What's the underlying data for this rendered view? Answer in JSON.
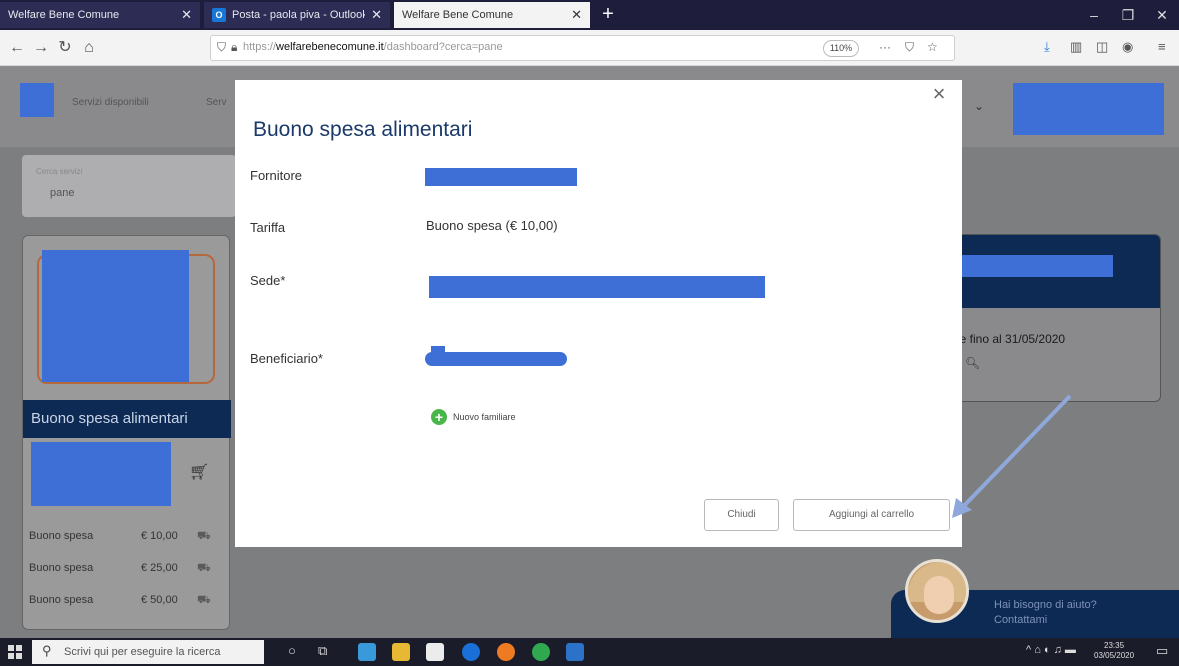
{
  "browser": {
    "tabs": [
      {
        "title": "Welfare Bene Comune",
        "active": false
      },
      {
        "title": "Posta - paola piva - Outlook",
        "active": false
      },
      {
        "title": "Welfare Bene Comune",
        "active": true
      }
    ],
    "url_prefix": "https://",
    "url_domain": "welfarebenecomune.it",
    "url_path": "/dashboard?cerca=pane",
    "zoom": "110%"
  },
  "page": {
    "nav_items": [
      "Servizi disponibili",
      "Serv"
    ],
    "search_label": "Cerca servizi",
    "search_value": "pane",
    "product": {
      "title": "Buono spesa alimentari",
      "prices": [
        {
          "label": "Buono spesa",
          "amount": "€ 10,00"
        },
        {
          "label": "Buono spesa",
          "amount": "€ 25,00"
        },
        {
          "label": "Buono spesa",
          "amount": "€ 50,00"
        }
      ]
    },
    "right_card_text": "le fino al 31/05/2020",
    "chat": {
      "line1": "Hai bisogno di aiuto?",
      "line2": "Contattami"
    }
  },
  "modal": {
    "title": "Buono spesa alimentari",
    "fields": {
      "fornitore_label": "Fornitore",
      "tariffa_label": "Tariffa",
      "tariffa_value": "Buono spesa (€ 10,00)",
      "sede_label": "Sede*",
      "beneficiario_label": "Beneficiario*"
    },
    "nuovo_familiare": "Nuovo familiare",
    "buttons": {
      "close": "Chiudi",
      "add": "Aggiungi al carrello"
    }
  },
  "taskbar": {
    "search_placeholder": "Scrivi qui per eseguire la ricerca",
    "time": "23:35",
    "date": "03/05/2020"
  },
  "colors": {
    "accent_blue": "#3e6fd6",
    "navy": "#0d2a55",
    "arrow": "#8fa8dc"
  }
}
